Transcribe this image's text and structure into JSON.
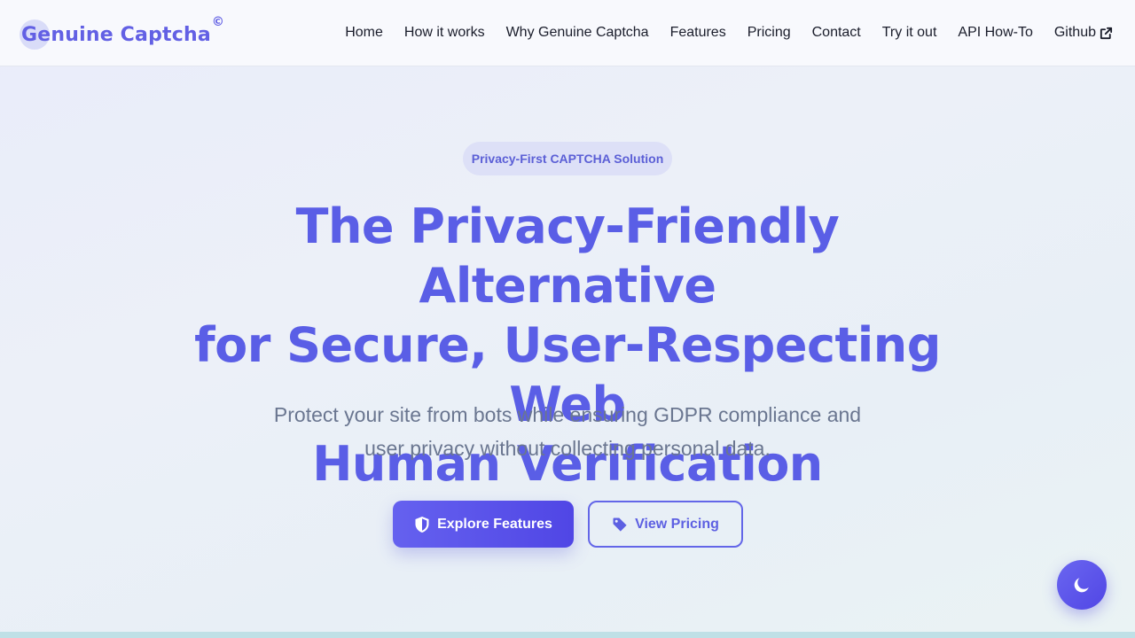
{
  "header": {
    "logo_text": "Genuine Captcha",
    "logo_mark": "©",
    "nav": [
      {
        "label": "Home"
      },
      {
        "label": "How it works"
      },
      {
        "label": "Why Genuine Captcha"
      },
      {
        "label": "Features"
      },
      {
        "label": "Pricing"
      },
      {
        "label": "Contact"
      },
      {
        "label": "Try it out"
      },
      {
        "label": "API How-To"
      },
      {
        "label": "Github",
        "icon": "external-link-icon"
      }
    ]
  },
  "hero": {
    "badge": "Privacy-First CAPTCHA Solution",
    "title_line1": "The Privacy-Friendly Alternative",
    "title_line2": "for Secure, User-Respecting Web",
    "title_line3": "Human Verification",
    "subtitle_line1": "Protect your site from bots while ensuring GDPR compliance and",
    "subtitle_line2": "user privacy without collecting personal data.",
    "primary_button": {
      "label": "Explore Features",
      "icon": "shield-icon"
    },
    "secondary_button": {
      "label": "View Pricing",
      "icon": "tag-icon"
    }
  },
  "theme_toggle": {
    "icon": "moon-icon"
  },
  "colors": {
    "accent": "#5a5ee6",
    "button_gradient_start": "#6561ef",
    "button_gradient_end": "#5046e5",
    "subtitle": "#6a7690",
    "badge_bg": "#dde0f7"
  }
}
